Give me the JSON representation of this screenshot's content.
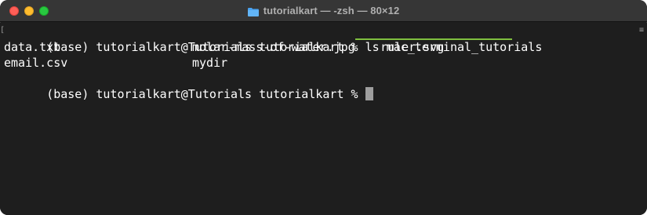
{
  "window": {
    "title": "tutorialkart — -zsh — 80×12",
    "folder_icon_color": "#4aa3f0",
    "traffic_lights": {
      "close": "#ff5f57",
      "minimize": "#febc2e",
      "zoom": "#28c840"
    }
  },
  "terminal": {
    "line1": {
      "prompt": "(base) tutorialkart@Tutorials tutorialkart % ",
      "command": "ls mac_terminal_tutorials"
    },
    "line2": {
      "col1": "data.txt",
      "col2": "molar-mass-of-water.jpg",
      "col3": "ruler.svg"
    },
    "line3": {
      "col1": "email.csv",
      "col2": "mydir"
    },
    "line4": {
      "prompt": "(base) tutorialkart@Tutorials tutorialkart % "
    },
    "highlight_color": "#7fbf3f",
    "background": "#1e1e1e",
    "foreground": "#ffffff"
  }
}
